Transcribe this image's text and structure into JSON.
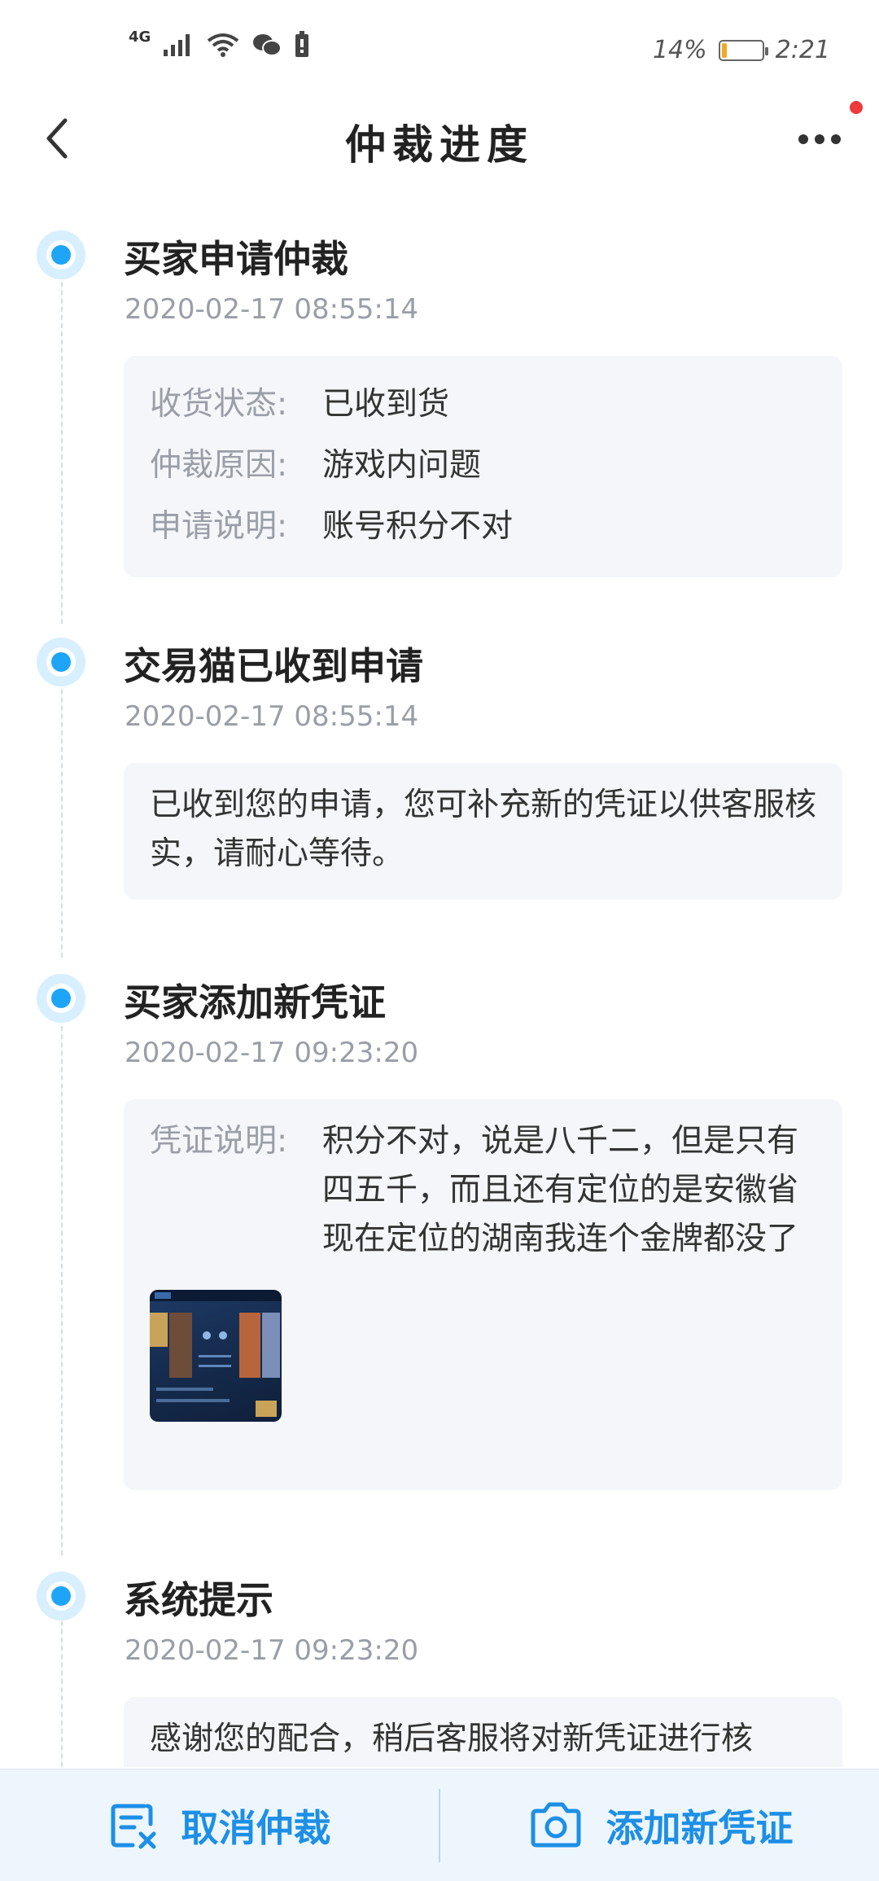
{
  "status_bar": {
    "network": "4G",
    "battery_percent": "14%",
    "battery_level": 0.14,
    "time": "2:21"
  },
  "header": {
    "title": "仲裁进度",
    "back_icon": "chevron-left-icon",
    "more_icon": "more-horizontal-icon"
  },
  "events": [
    {
      "title": "买家申请仲裁",
      "time": "2020-02-17 08:55:14",
      "fields": [
        {
          "label": "收货状态:",
          "value": "已收到货"
        },
        {
          "label": "仲裁原因:",
          "value": "游戏内问题"
        },
        {
          "label": "申请说明:",
          "value": "账号积分不对"
        }
      ]
    },
    {
      "title": "交易猫已收到申请",
      "time": "2020-02-17 08:55:14",
      "text": "已收到您的申请，您可补充新的凭证以供客服核实，请耐心等待。"
    },
    {
      "title": "买家添加新凭证",
      "time": "2020-02-17 09:23:20",
      "fields": [
        {
          "label": "凭证说明:",
          "value": "积分不对，说是八千二，但是只有四五千，而且还有定位的是安徽省现在定位的湖南我连个金牌都没了"
        }
      ]
    },
    {
      "title": "系统提示",
      "time": "2020-02-17 09:23:20",
      "text": "感谢您的配合，稍后客服将对新凭证进行核"
    }
  ],
  "bottom_bar": {
    "cancel_label": "取消仲裁",
    "add_label": "添加新凭证"
  },
  "colors": {
    "accent": "#1d8fe6",
    "node": "#1ea5f7",
    "card_bg": "#f4f6f9",
    "notify_dot": "#f0393a"
  }
}
